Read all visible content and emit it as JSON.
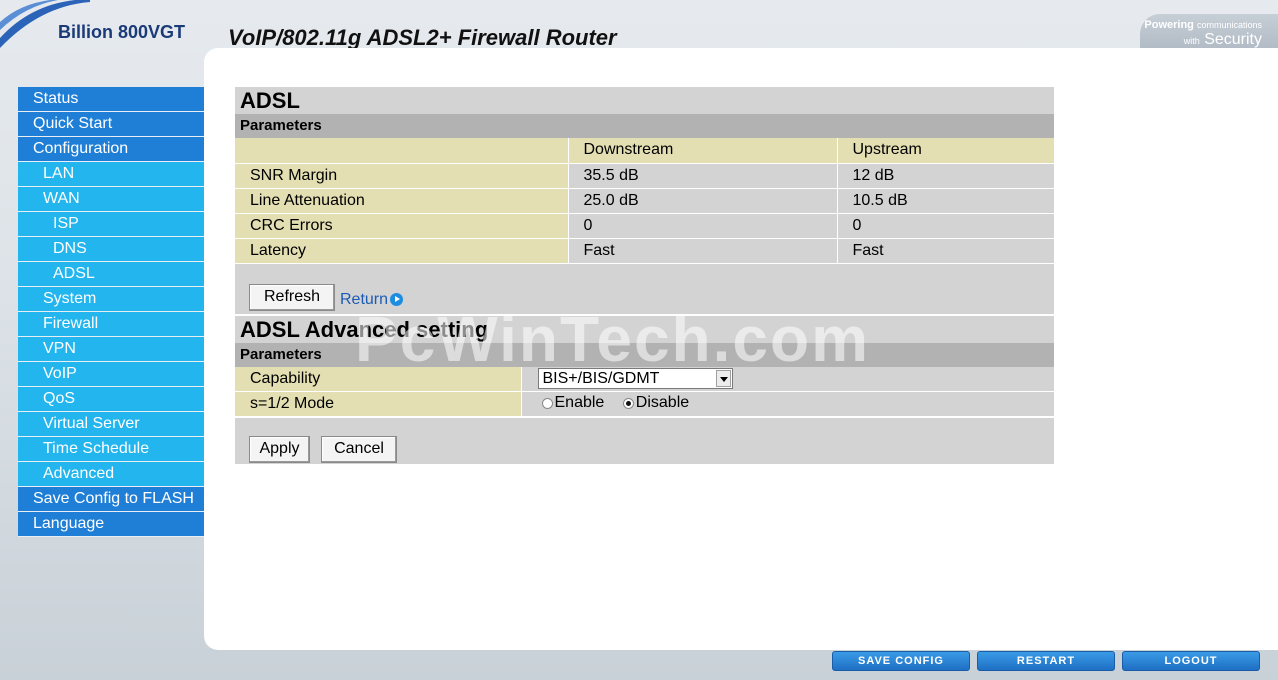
{
  "header": {
    "brand": "Billion 800VGT",
    "product_title": "VoIP/802.11g ADSL2+ Firewall Router",
    "powering_word": "Powering",
    "powering_small": "communications",
    "with_word": "with",
    "security_word": "Security"
  },
  "sidebar": {
    "items": [
      {
        "label": "Status"
      },
      {
        "label": "Quick Start"
      },
      {
        "label": "Configuration"
      },
      {
        "label": "LAN"
      },
      {
        "label": "WAN"
      },
      {
        "label": "ISP"
      },
      {
        "label": "DNS"
      },
      {
        "label": "ADSL"
      },
      {
        "label": "System"
      },
      {
        "label": "Firewall"
      },
      {
        "label": "VPN"
      },
      {
        "label": "VoIP"
      },
      {
        "label": "QoS"
      },
      {
        "label": "Virtual Server"
      },
      {
        "label": "Time Schedule"
      },
      {
        "label": "Advanced"
      },
      {
        "label": "Save Config to FLASH"
      },
      {
        "label": "Language"
      }
    ]
  },
  "adsl": {
    "title": "ADSL",
    "subheading": "Parameters",
    "columns": [
      "",
      "Downstream",
      "Upstream"
    ],
    "rows": [
      {
        "label": "SNR Margin",
        "down": "35.5 dB",
        "up": "12 dB"
      },
      {
        "label": "Line Attenuation",
        "down": "25.0 dB",
        "up": "10.5 dB"
      },
      {
        "label": "CRC Errors",
        "down": "0",
        "up": "0"
      },
      {
        "label": "Latency",
        "down": "Fast",
        "up": "Fast"
      }
    ],
    "refresh_label": "Refresh",
    "return_label": "Return"
  },
  "advanced": {
    "title": "ADSL Advanced setting",
    "subheading": "Parameters",
    "capability_label": "Capability",
    "capability_value": "BIS+/BIS/GDMT",
    "mode_label": "s=1/2 Mode",
    "enable_label": "Enable",
    "disable_label": "Disable",
    "selected_mode": "Disable",
    "apply_label": "Apply",
    "cancel_label": "Cancel"
  },
  "watermark": "PcWinTech.com",
  "footer": {
    "save_config": "SAVE CONFIG",
    "restart": "RESTART",
    "logout": "LOGOUT"
  }
}
